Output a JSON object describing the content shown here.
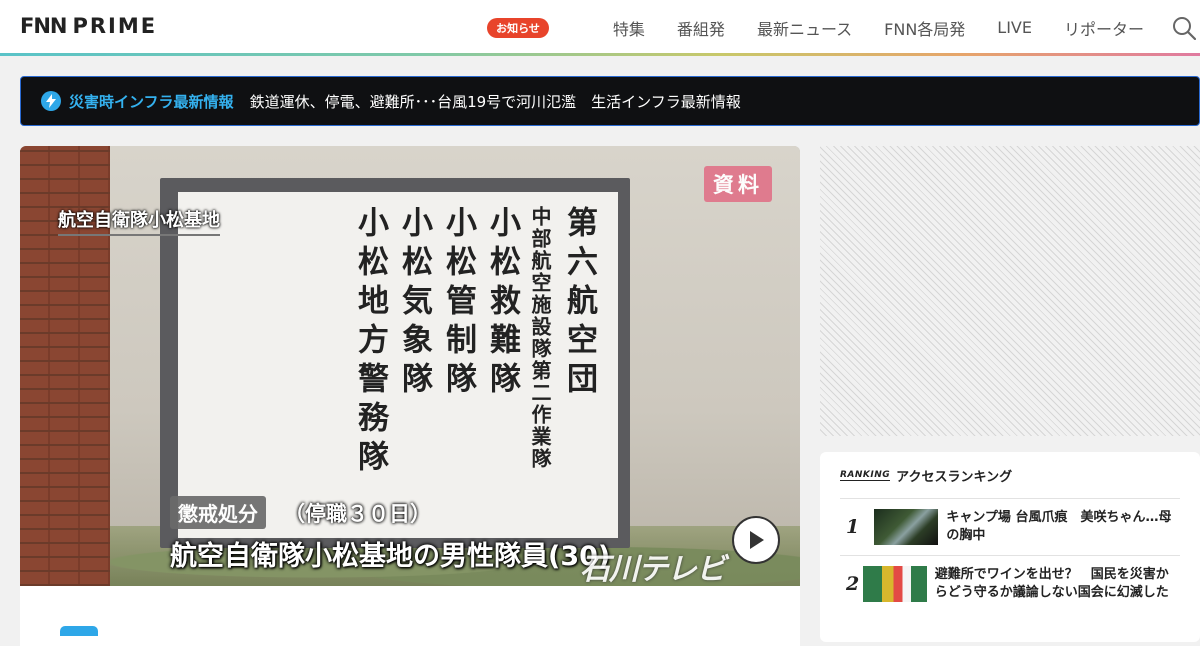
{
  "header": {
    "logo_mark": "FNN",
    "logo_text": "PRIME",
    "notice_badge": "お知らせ",
    "nav": [
      "特集",
      "番組発",
      "最新ニュース",
      "FNN各局発",
      "LIVE",
      "リポーター"
    ]
  },
  "alert": {
    "title": "災害時インフラ最新情報",
    "text": "鉄道運休、停電、避難所･･･台風19号で河川氾濫　生活インフラ最新情報"
  },
  "hero": {
    "caption_location": "航空自衛隊小松基地",
    "shiryo_label": "資料",
    "sign_columns": [
      "第六航空団",
      "中部航空施設隊第二作業隊",
      "小松救難隊",
      "小松管制隊",
      "小松気象隊",
      "小松地方警務隊"
    ],
    "tag_discipline": "懲戒処分",
    "tag_suspend": "（停職３０日）",
    "caption_main": "航空自衛隊小松基地の男性隊員(30)",
    "station_logo": "石川テレビ"
  },
  "ranking": {
    "logo": "RANKING",
    "title": "アクセスランキング",
    "items": [
      {
        "rank": "1",
        "text": "キャンプ場 台風爪痕　美咲ちゃん…母の胸中"
      },
      {
        "rank": "2",
        "text": "避難所でワインを出せ？　国民を災害からどう守るか議論しない国会に幻滅した"
      }
    ]
  },
  "colors": {
    "notice_badge": "#e8442b",
    "alert_accent": "#34b1ee",
    "alert_background": "#0f1012"
  }
}
